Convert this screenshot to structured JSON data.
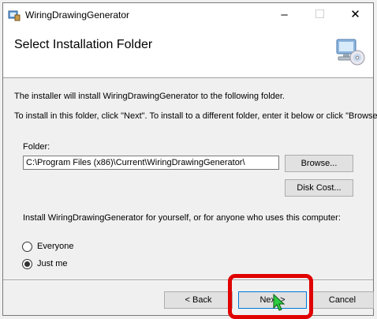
{
  "window": {
    "title": "WiringDrawingGenerator",
    "controls": {
      "minimize": "–",
      "maximize": "☐",
      "close": "✕"
    }
  },
  "header": {
    "title": "Select Installation Folder",
    "icon": "computer-cd-icon"
  },
  "body": {
    "intro": "The installer will install WiringDrawingGenerator to the following folder.",
    "instructions": "To install in this folder, click \"Next\". To install to a different folder, enter it below or click \"Browse\".",
    "folder_label": "Folder:",
    "folder_value": "C:\\Program Files (x86)\\Current\\WiringDrawingGenerator\\",
    "browse_label": "Browse...",
    "disk_cost_label": "Disk Cost...",
    "install_for_label": "Install WiringDrawingGenerator for yourself, or for anyone who uses this computer:",
    "options": [
      {
        "label": "Everyone",
        "selected": false
      },
      {
        "label": "Just me",
        "selected": true
      }
    ]
  },
  "footer": {
    "back_label": "< Back",
    "next_label": "Next >",
    "cancel_label": "Cancel"
  },
  "colors": {
    "highlight": "#e00000",
    "cursor": "#2ecc40"
  }
}
